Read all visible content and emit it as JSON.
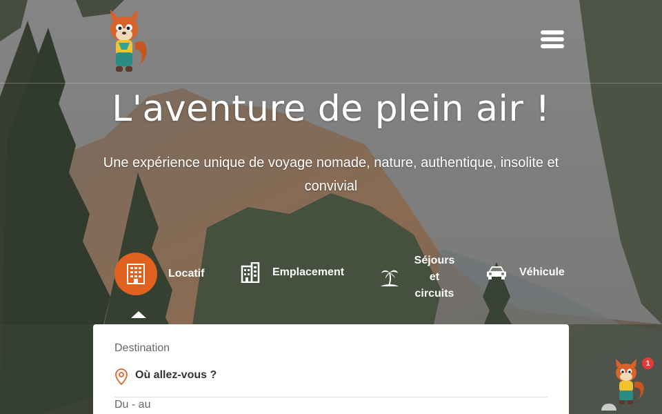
{
  "header": {
    "logo_icon": "squirrel-mascot-icon",
    "menu_icon": "hamburger-menu-icon"
  },
  "hero": {
    "title": "L'aventure de plein air !",
    "subtitle": "Une expérience unique de voyage nomade, nature, authentique, insolite et convivial"
  },
  "tabs": [
    {
      "label": "Locatif",
      "icon": "building-icon",
      "active": true
    },
    {
      "label": "Emplacement",
      "icon": "apartment-icon",
      "active": false
    },
    {
      "label": "Séjours et circuits",
      "label_lines": [
        "Séjours",
        "et",
        "circuits"
      ],
      "icon": "palm-island-icon",
      "active": false
    },
    {
      "label": "Véhicule",
      "icon": "car-icon",
      "active": false
    }
  ],
  "search": {
    "destination_label": "Destination",
    "destination_placeholder": "Où allez-vous ?",
    "destination_icon": "location-pin-icon",
    "dates_label": "Du - au"
  },
  "chat": {
    "icon": "squirrel-mascot-icon",
    "badge_count": "1"
  },
  "colors": {
    "accent": "#e0621e",
    "badge": "#e53935",
    "card_bg": "#ffffff"
  }
}
